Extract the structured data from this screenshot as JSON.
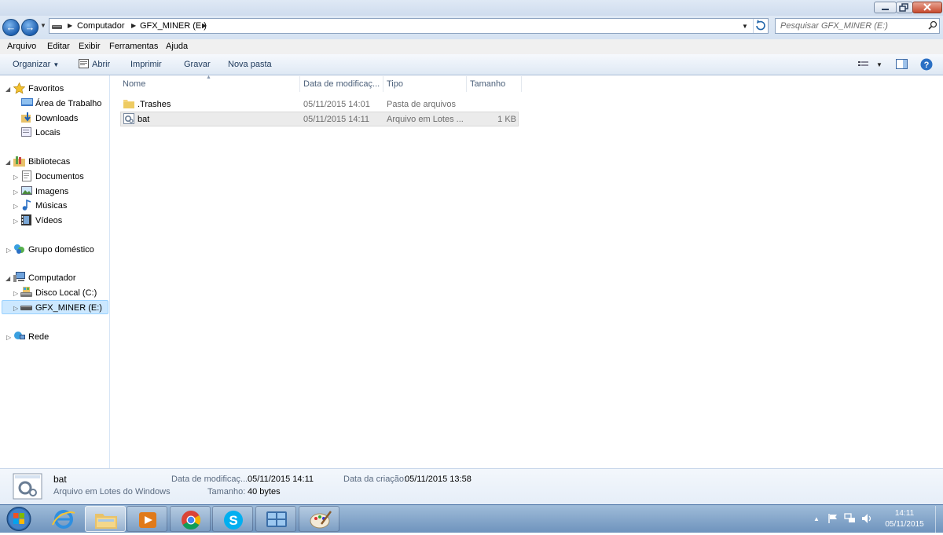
{
  "breadcrumb": [
    "Computador",
    "GFX_MINER (E:)"
  ],
  "search": {
    "placeholder": "Pesquisar GFX_MINER (E:)"
  },
  "menu": [
    "Arquivo",
    "Editar",
    "Exibir",
    "Ferramentas",
    "Ajuda"
  ],
  "toolbar": {
    "organize": "Organizar",
    "open": "Abrir",
    "print": "Imprimir",
    "burn": "Gravar",
    "new_folder": "Nova pasta"
  },
  "nav": {
    "favorites": "Favoritos",
    "desktop": "Área de Trabalho",
    "downloads": "Downloads",
    "places": "Locais",
    "libraries": "Bibliotecas",
    "documents": "Documentos",
    "images": "Imagens",
    "music": "Músicas",
    "videos": "Vídeos",
    "homegroup": "Grupo doméstico",
    "computer": "Computador",
    "local_disk": "Disco Local (C:)",
    "gfx_miner": "GFX_MINER (E:)",
    "network": "Rede"
  },
  "columns": {
    "name": "Nome",
    "modified": "Data de modificaç...",
    "type": "Tipo",
    "size": "Tamanho"
  },
  "files": [
    {
      "name": ".Trashes",
      "modified": "05/11/2015 14:01",
      "type": "Pasta de arquivos",
      "size": ""
    },
    {
      "name": "bat",
      "modified": "05/11/2015 14:11",
      "type": "Arquivo em Lotes ...",
      "size": "1 KB"
    }
  ],
  "details": {
    "name": "bat",
    "kind": "Arquivo em Lotes do Windows",
    "modified_label": "Data de modificaç...",
    "modified_value": "05/11/2015 14:11",
    "size_label": "Tamanho:",
    "size_value": "40 bytes",
    "created_label": "Data da criação:",
    "created_value": "05/11/2015 13:58"
  },
  "clock": {
    "time": "14:11",
    "date": "05/11/2015"
  },
  "colors": {
    "selection": "#cce8ff",
    "taskbar": "#6e93bd"
  }
}
